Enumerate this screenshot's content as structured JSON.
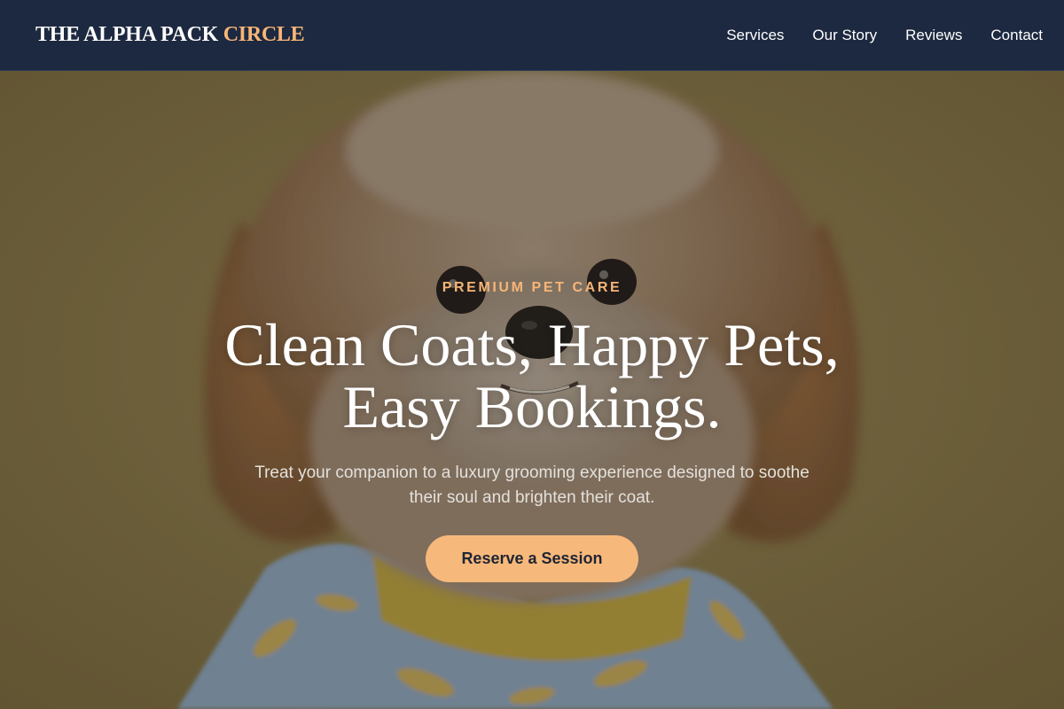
{
  "brand": {
    "name_main": "THE ALPHA PACK",
    "name_accent": "CIRCLE",
    "accent_color": "#f7b577"
  },
  "nav": {
    "items": [
      {
        "label": "Services"
      },
      {
        "label": "Our Story"
      },
      {
        "label": "Reviews"
      },
      {
        "label": "Contact"
      }
    ]
  },
  "hero": {
    "eyebrow": "PREMIUM PET CARE",
    "headline_line1": "Clean Coats, Happy Pets,",
    "headline_line2": "Easy Bookings.",
    "subtitle": "Treat your companion to a luxury grooming experience designed to soothe their soul and brighten their coat.",
    "cta_label": "Reserve a Session",
    "image": "fluffy-dog-in-banana-shirt"
  },
  "colors": {
    "navbar_bg": "#1d2940",
    "hero_bg": "#76683f",
    "cta_bg": "#f7b97b"
  }
}
